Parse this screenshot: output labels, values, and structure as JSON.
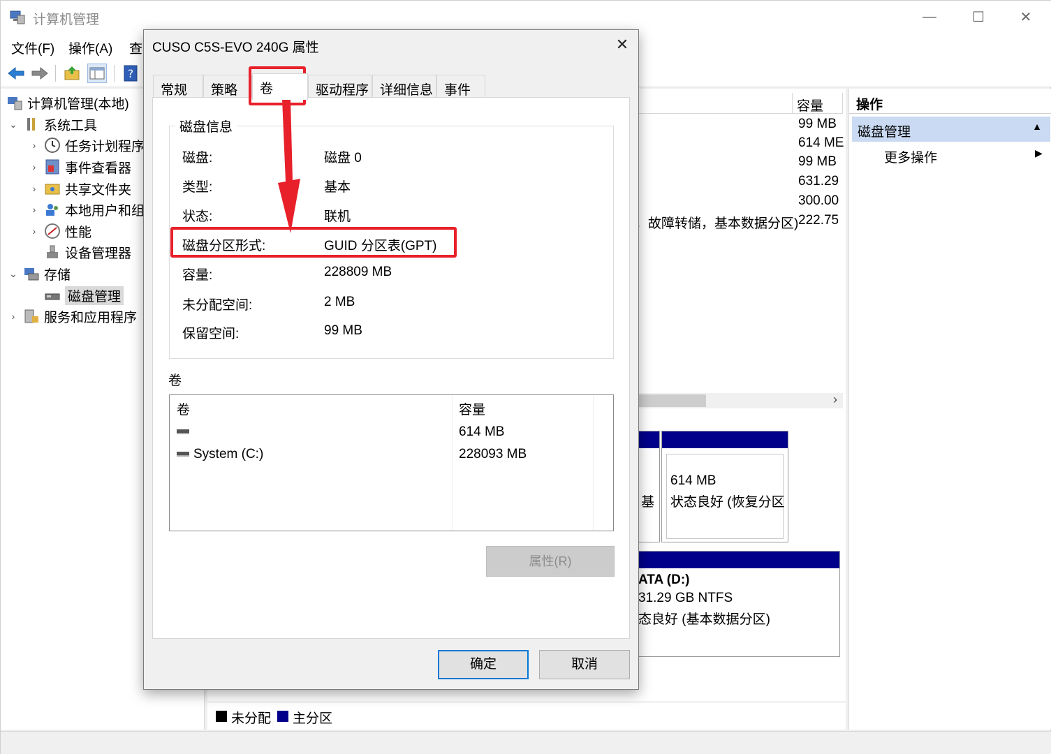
{
  "app": {
    "title": "计算机管理",
    "window_controls": {
      "minimize": "—",
      "maximize": "☐",
      "close": "✕"
    }
  },
  "menubar": {
    "items": [
      "文件(F)",
      "操作(A)",
      "查"
    ]
  },
  "tree": {
    "root": "计算机管理(本地)",
    "system_tools": "系统工具",
    "task_scheduler": "任务计划程序",
    "event_viewer": "事件查看器",
    "shared_folders": "共享文件夹",
    "local_users": "本地用户和组",
    "performance": "性能",
    "device_manager": "设备管理器",
    "storage": "存储",
    "disk_management": "磁盘管理",
    "services_apps": "服务和应用程序"
  },
  "center": {
    "col_capacity": "容量",
    "capacities": [
      "99 MB",
      "614 ME",
      "99 MB",
      "631.29",
      "300.00",
      "222.75"
    ],
    "row6_text": "，故障转储，基本数据分区)",
    "block1_label_left": "基",
    "block1_size": "614 MB",
    "block1_status": "状态良好 (恢复分区",
    "block2_name": "ATA  (D:)",
    "block2_size": "31.29 GB NTFS",
    "block2_status": "态良好 (基本数据分区)",
    "legend_unallocated": "未分配",
    "legend_primary": "主分区",
    "colors": {
      "partition_header": "#00008b",
      "unallocated": "#000000",
      "primary": "#00008b"
    }
  },
  "actions": {
    "header": "操作",
    "section": "磁盘管理",
    "more": "更多操作"
  },
  "dialog": {
    "title": "CUSO C5S-EVO 240G 属性",
    "close": "✕",
    "tabs": [
      "常规",
      "策略",
      "卷",
      "驱动程序",
      "详细信息",
      "事件"
    ],
    "active_tab": "卷",
    "disk_info_title": "磁盘信息",
    "disk_info": [
      {
        "key": "磁盘:",
        "value": "磁盘 0"
      },
      {
        "key": "类型:",
        "value": "基本"
      },
      {
        "key": "状态:",
        "value": "联机"
      },
      {
        "key": "磁盘分区形式:",
        "value": "GUID 分区表(GPT)"
      },
      {
        "key": "容量:",
        "value": "228809 MB"
      },
      {
        "key": "未分配空间:",
        "value": "2 MB"
      },
      {
        "key": "保留空间:",
        "value": "99 MB"
      }
    ],
    "volumes_title": "卷",
    "volumes_header": {
      "volume": "卷",
      "capacity": "容量"
    },
    "volumes": [
      {
        "name": "",
        "capacity": "614 MB"
      },
      {
        "name": "System (C:)",
        "capacity": "228093 MB"
      }
    ],
    "properties_button": "属性(R)",
    "ok_button": "确定",
    "cancel_button": "取消"
  },
  "annotation_color": "#e8202a"
}
